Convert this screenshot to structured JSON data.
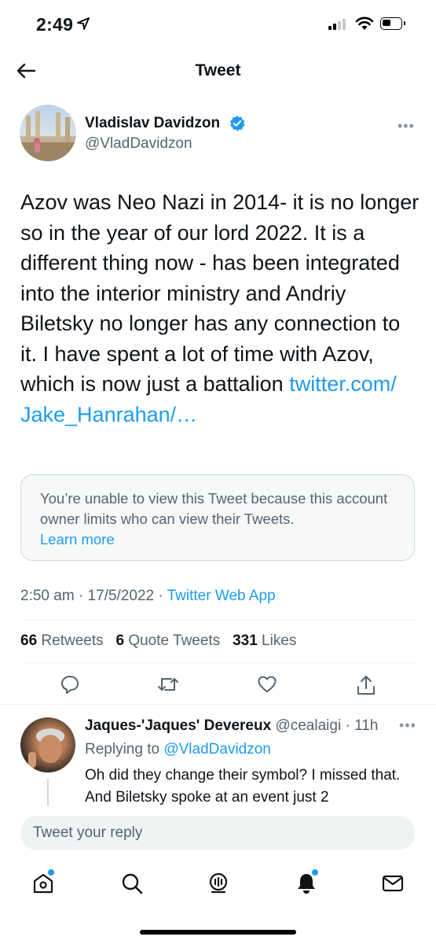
{
  "status_bar": {
    "time": "2:49"
  },
  "header": {
    "title": "Tweet"
  },
  "author": {
    "name": "Vladislav Davidzon",
    "handle": "@VladDavidzon"
  },
  "tweet": {
    "text": "Azov was Neo Nazi in 2014- it is no longer so in the year of our lord 2022. It is a different thing now - has been integrated into the interior ministry and Andriy Biletsky no longer has any connection to it. I have spent a lot of time with Azov, which is now just a battalion ",
    "link": "twitter.com/ Jake_Hanrahan/…",
    "quote_notice": "You’re unable to view this Tweet because this account owner limits who can view their Tweets.",
    "quote_learn_more": "Learn more",
    "time": "2:50 am",
    "date": "17/5/2022",
    "source": "Twitter Web App"
  },
  "stats": {
    "retweets_count": "66",
    "retweets_label": "Retweets",
    "quotes_count": "6",
    "quotes_label": "Quote Tweets",
    "likes_count": "331",
    "likes_label": "Likes"
  },
  "reply": {
    "name": "Jaques-'Jaques' Devereux",
    "handle": "@cealaigi",
    "age": "11h",
    "replying_prefix": "Replying to",
    "replying_to": "@VladDavidzon",
    "text": "Oh did they change their symbol? I missed that. And Biletsky spoke at an event just 2"
  },
  "compose": {
    "placeholder": "Tweet your reply"
  },
  "colors": {
    "accent": "#1d9bf0",
    "secondary_text": "#536471",
    "primary_text": "#0f1419"
  }
}
